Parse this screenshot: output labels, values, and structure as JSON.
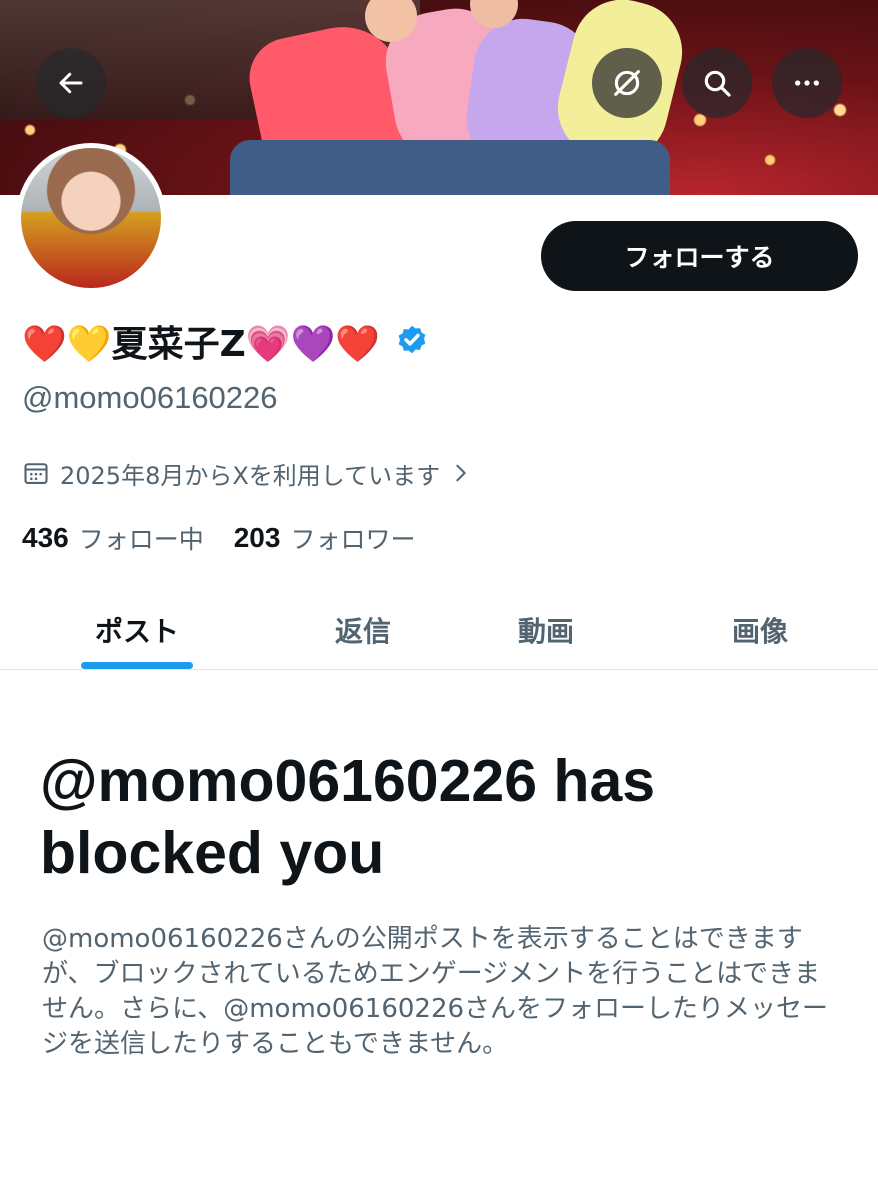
{
  "profile": {
    "display_name": "❤️💛夏菜子Z💗💜❤️",
    "handle": "@momo06160226",
    "joined_text": "2025年8月からXを利用しています",
    "following_count": "436",
    "following_label": "フォロー中",
    "followers_count": "203",
    "followers_label": "フォロワー"
  },
  "actions": {
    "follow_label": "フォローする"
  },
  "tabs": [
    {
      "label": "ポスト",
      "active": true
    },
    {
      "label": "返信",
      "active": false
    },
    {
      "label": "動画",
      "active": false
    },
    {
      "label": "画像",
      "active": false
    }
  ],
  "blocked": {
    "title": "@momo06160226 has blocked you",
    "message": "@momo06160226さんの公開ポストを表示することはできますが、ブロックされているためエンゲージメントを行うことはできません。さらに、@momo06160226さんをフォローしたりメッセージを送信したりすることもできません。"
  },
  "icons": {
    "back": "arrow-left-icon",
    "grok": "grok-icon",
    "search": "search-icon",
    "more": "more-icon",
    "verified": "verified-badge-icon",
    "calendar": "calendar-icon",
    "chevron": "chevron-right-icon"
  },
  "colors": {
    "accent": "#1d9bf0",
    "text_primary": "#0f1419",
    "text_secondary": "#536471",
    "button_dark": "#0f1419"
  }
}
